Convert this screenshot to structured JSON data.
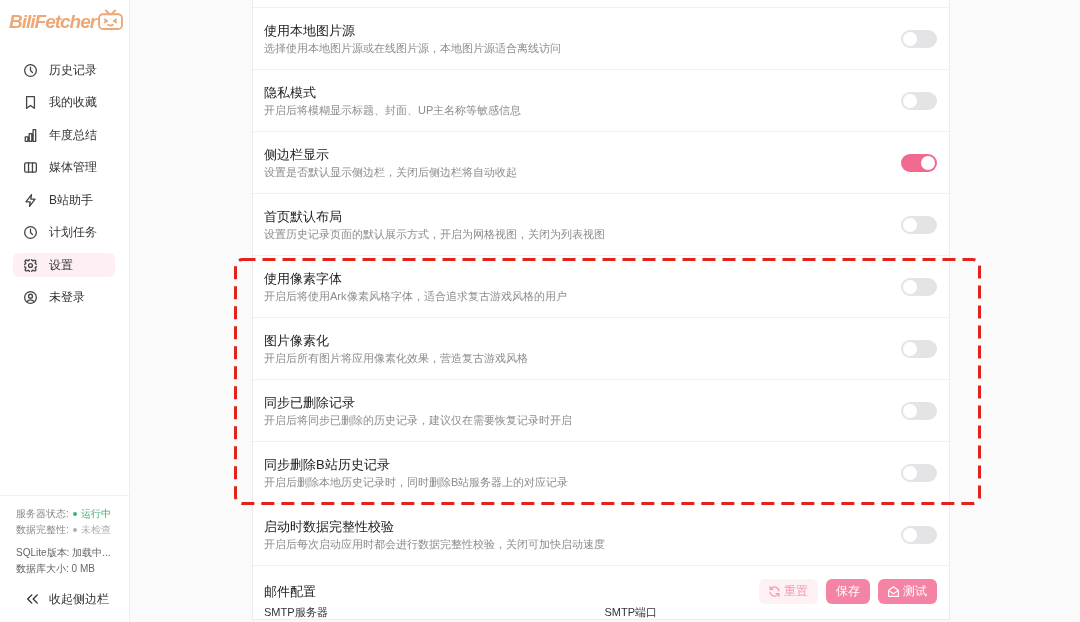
{
  "sidebar": {
    "logo": "BiliFetcher",
    "nav": [
      {
        "label": "历史记录",
        "selected": false
      },
      {
        "label": "我的收藏",
        "selected": false
      },
      {
        "label": "年度总结",
        "selected": false
      },
      {
        "label": "媒体管理",
        "selected": false
      },
      {
        "label": "B站助手",
        "selected": false
      },
      {
        "label": "计划任务",
        "selected": false
      },
      {
        "label": "设置",
        "selected": true
      },
      {
        "label": "未登录",
        "selected": false
      }
    ],
    "status": [
      {
        "label": "服务器状态:",
        "value": "运行中",
        "color": "#3bb371"
      },
      {
        "label": "数据完整性:",
        "value": "未检查",
        "color": "#b0b0b0"
      }
    ],
    "info": [
      "SQLite版本: 加载中...",
      "数据库大小: 0 MB"
    ],
    "collapse": "收起侧边栏"
  },
  "settings": [
    {
      "title": "使用本地图片源",
      "description": "选择使用本地图片源或在线图片源，本地图片源适合离线访问",
      "on": false,
      "highlighted": false
    },
    {
      "title": "隐私模式",
      "description": "开启后将模糊显示标题、封面、UP主名称等敏感信息",
      "on": false,
      "highlighted": false
    },
    {
      "title": "侧边栏显示",
      "description": "设置是否默认显示侧边栏，关闭后侧边栏将自动收起",
      "on": true,
      "highlighted": false
    },
    {
      "title": "首页默认布局",
      "description": "设置历史记录页面的默认展示方式，开启为网格视图，关闭为列表视图",
      "on": false,
      "highlighted": false
    },
    {
      "title": "使用像素字体",
      "description": "开启后将使用Ark像素风格字体，适合追求复古游戏风格的用户",
      "on": false,
      "highlighted": true
    },
    {
      "title": "图片像素化",
      "description": "开启后所有图片将应用像素化效果，营造复古游戏风格",
      "on": false,
      "highlighted": true
    },
    {
      "title": "同步已删除记录",
      "description": "开启后将同步已删除的历史记录，建议仅在需要恢复记录时开启",
      "on": false,
      "highlighted": true
    },
    {
      "title": "同步删除B站历史记录",
      "description": "开启后删除本地历史记录时，同时删除B站服务器上的对应记录",
      "on": false,
      "highlighted": true
    },
    {
      "title": "启动时数据完整性校验",
      "description": "开启后每次启动应用时都会进行数据完整性校验，关闭可加快启动速度",
      "on": false,
      "highlighted": false
    }
  ],
  "email_config": {
    "title": "邮件配置",
    "buttons": [
      {
        "label": "重置",
        "kind": "light"
      },
      {
        "label": "保存",
        "kind": "solid"
      },
      {
        "label": "测试",
        "kind": "solid"
      }
    ],
    "fields": [
      {
        "label": "SMTP服务器"
      },
      {
        "label": "SMTP端口"
      }
    ]
  }
}
